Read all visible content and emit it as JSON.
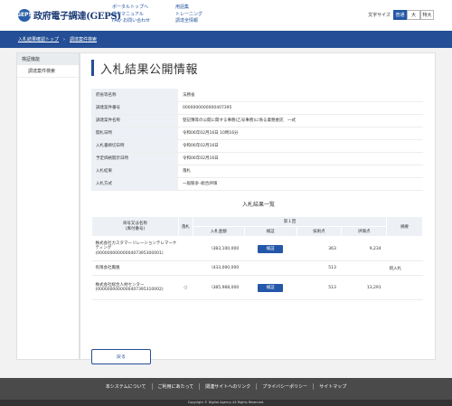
{
  "header": {
    "logo_mark": "GEPS",
    "logo_text": "政府電子調達(GEPS)",
    "nav_col1": [
      "ポータルトップへ",
      "操作マニュアル",
      "FAQ･お問い合わせ"
    ],
    "nav_col2": [
      "用語集",
      "トレーニング",
      "調達全情報"
    ],
    "font_size_label": "文字サイズ",
    "font_sizes": [
      "普通",
      "大",
      "特大"
    ]
  },
  "breadcrumb": [
    "入札結果確認トップ",
    "調達案件検索"
  ],
  "sidebar": {
    "heading": "検証機能",
    "items": [
      "調達案件検索"
    ]
  },
  "main": {
    "title": "入札結果公開情報",
    "info": [
      {
        "label": "府省等名称",
        "value": "法務省"
      },
      {
        "label": "調達案件番号",
        "value": "0000000000000407395"
      },
      {
        "label": "調達案件名称",
        "value": "登記簿等の公開に関する事務(乙号事務)に係る業務委託　一式"
      },
      {
        "label": "開札日時",
        "value": "令和06年02月16日 10時16分"
      },
      {
        "label": "入札書締切日時",
        "value": "令和06年02月16日"
      },
      {
        "label": "予定価格開示日時",
        "value": "令和06年02月16日"
      },
      {
        "label": "入札結果",
        "value": "落札"
      },
      {
        "label": "入札方式",
        "value": "一般競争･総合評価"
      }
    ],
    "results_title": "入札結果一覧",
    "results_headers": {
      "company": "商号又は名称\n(库付番号)",
      "winner": "落札",
      "round": "第１回",
      "amount": "入札金額",
      "verify": "検証",
      "tech": "技術点",
      "score": "評価点",
      "remarks": "摘要"
    },
    "results": [
      {
        "company": "株式会社カスタマーリレーションテレマーケティング(0000000000000407395300001)",
        "winner": "",
        "amount": "\\383,100,000",
        "verify": "検証",
        "tech": "363",
        "score": "9,234",
        "remarks": ""
      },
      {
        "company": "有限会社鳳凰",
        "winner": "",
        "amount": "\\433,000,000",
        "verify": "",
        "tech": "513",
        "score": "",
        "remarks": "続入札"
      },
      {
        "company": "株式会社総合人材センター(0000000000000407395310002)",
        "winner": "○",
        "amount": "\\385,968,000",
        "verify": "検証",
        "tech": "513",
        "score": "13,291",
        "remarks": ""
      }
    ],
    "back_label": "戻る"
  },
  "footer": {
    "links": [
      "本システムについて",
      "ご利用にあたって",
      "関連サイトへのリンク",
      "プライバシーポリシー",
      "サイトマップ"
    ],
    "copyright": "Copyright © Digital Agency All Rights Reserved."
  },
  "colors": {
    "primary": "#244e95",
    "button": "#2457a8",
    "header_bg": "#edf1f6"
  }
}
